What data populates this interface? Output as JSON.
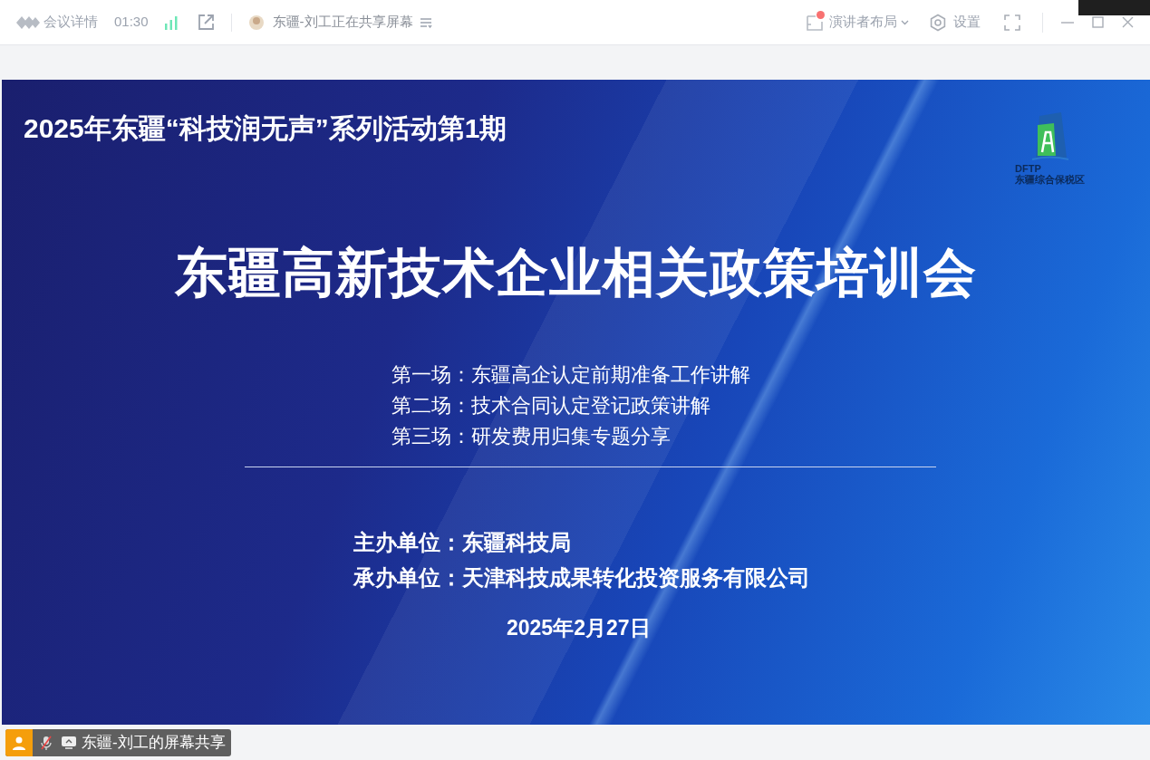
{
  "toolbar": {
    "app_label": "会议详情",
    "time": "01:30",
    "sharer_status": "东疆-刘工正在共享屏幕",
    "layout_button": "演讲者布局",
    "layout_notice": true,
    "settings": "设置"
  },
  "slide": {
    "series_title": "2025年东疆“科技润无声”系列活动第1期",
    "logo_abbr": "DFTP",
    "logo_name": "东疆综合保税区",
    "main_title": "东疆高新技术企业相关政策培训会",
    "sessions": [
      "第一场：东疆高企认定前期准备工作讲解",
      "第二场：技术合同认定登记政策讲解",
      "第三场：研发费用归集专题分享"
    ],
    "organizers": [
      "主办单位：东疆科技局",
      "承办单位：天津科技成果转化投资服务有限公司"
    ],
    "date": "2025年2月27日"
  },
  "footer": {
    "share_label": "东疆-刘工的屏幕共享",
    "mic_muted": true
  }
}
